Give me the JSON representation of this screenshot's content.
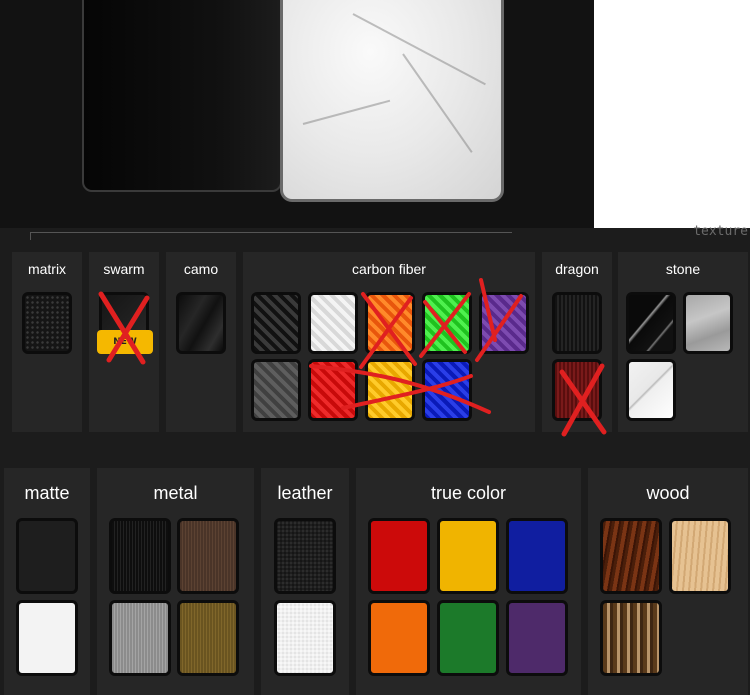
{
  "section_label": "texture",
  "colors": {
    "accent_x": "#e02020",
    "panel": "#262626",
    "background": "#1c1c1c"
  },
  "row1": [
    {
      "id": "matrix",
      "title": "matrix",
      "swatches": [
        "matrix-black"
      ]
    },
    {
      "id": "swarm",
      "title": "swarm",
      "badge": "NEW",
      "swatches": [
        "swarm-black"
      ]
    },
    {
      "id": "camo",
      "title": "camo",
      "swatches": [
        "camo-black"
      ]
    },
    {
      "id": "carbon-fiber",
      "title": "carbon fiber",
      "swatches": [
        "black",
        "white",
        "orange",
        "green",
        "purple",
        "grey",
        "red",
        "yellow",
        "blue"
      ]
    },
    {
      "id": "dragon",
      "title": "dragon",
      "swatches": [
        "black",
        "red"
      ]
    },
    {
      "id": "stone",
      "title": "stone",
      "swatches": [
        "black-marble",
        "grey-stone",
        "white-marble"
      ]
    }
  ],
  "row2": [
    {
      "id": "matte",
      "title": "matte",
      "swatches": [
        "black",
        "white"
      ]
    },
    {
      "id": "metal",
      "title": "metal",
      "swatches": [
        "black",
        "bronze",
        "silver",
        "gold"
      ]
    },
    {
      "id": "leather",
      "title": "leather",
      "swatches": [
        "black",
        "white"
      ]
    },
    {
      "id": "true-color",
      "title": "true color",
      "swatches": [
        "red",
        "yellow",
        "blue",
        "orange",
        "green",
        "purple"
      ]
    },
    {
      "id": "wood",
      "title": "wood",
      "swatches": [
        "rosewood",
        "maple",
        "zebrawood"
      ]
    }
  ]
}
